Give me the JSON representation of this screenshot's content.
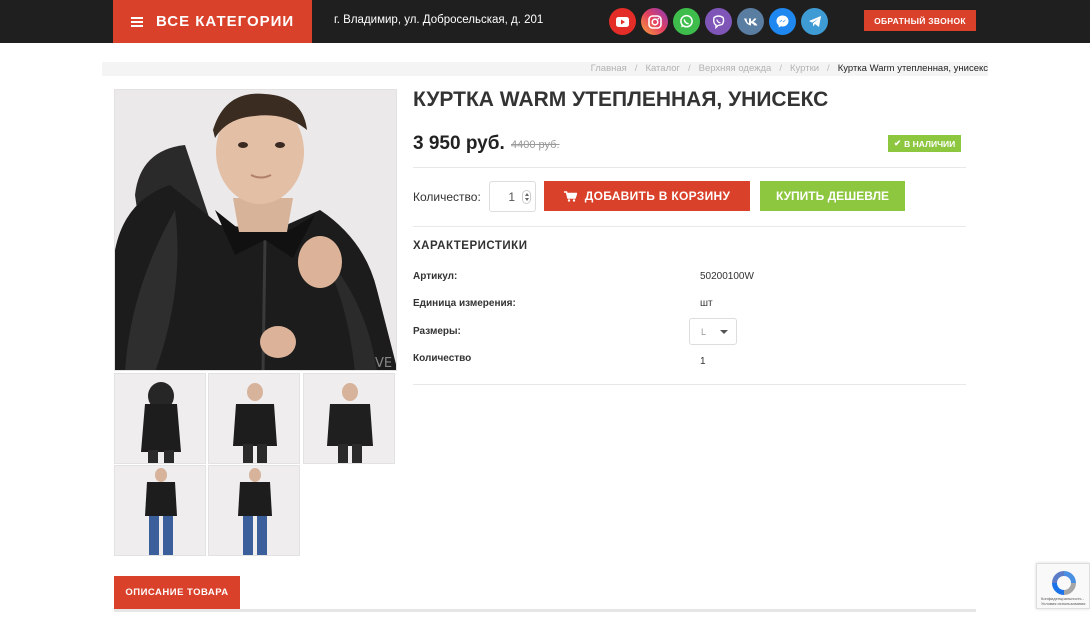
{
  "header": {
    "categories_label": "ВСЕ КАТЕГОРИИ",
    "address": "г. Владимир, ул. Добросельская, д. 201",
    "callback_label": "ОБРАТНЫЙ ЗВОНОК",
    "socials": [
      {
        "name": "youtube-icon",
        "color": "#e52d27"
      },
      {
        "name": "instagram-icon",
        "color": "#c13584"
      },
      {
        "name": "whatsapp-icon",
        "color": "#3ebd4d"
      },
      {
        "name": "viber-icon",
        "color": "#7f56b8"
      },
      {
        "name": "vk-icon",
        "color": "#5a7ea2"
      },
      {
        "name": "messenger-icon",
        "color": "#1e88f0"
      },
      {
        "name": "telegram-icon",
        "color": "#3f9bd3"
      }
    ]
  },
  "breadcrumbs": {
    "items": [
      "Главная",
      "Каталог",
      "Верхняя одежда",
      "Куртки"
    ],
    "current": "Куртка Warm утепленная, унисекс"
  },
  "product": {
    "title": "КУРТКА WARM УТЕПЛЕННАЯ, УНИСЕКС",
    "price": "3 950 руб.",
    "old_price": "4400 руб.",
    "stock": "В НАЛИЧИИ",
    "quantity_label": "Количество:",
    "quantity_value": "1",
    "add_to_cart": "ДОБАВИТЬ В КОРЗИНУ",
    "buy_cheaper": "КУПИТЬ ДЕШЕВЛЕ",
    "image_watermark": "VE"
  },
  "characteristics": {
    "title": "ХАРАКТЕРИСТИКИ",
    "rows": [
      {
        "key": "Артикул:",
        "value": "50200100W"
      },
      {
        "key": "Единица измерения:",
        "value": "шт"
      },
      {
        "key": "Размеры:",
        "value": "L"
      },
      {
        "key": "Количество",
        "value": "1"
      }
    ]
  },
  "tabs": {
    "description": "ОПИСАНИЕ ТОВАРА"
  },
  "recaptcha": {
    "text": "Конфиденциальность - Условия использования"
  },
  "colors": {
    "accent": "#d9412a",
    "green": "#8dc63f",
    "dark": "#1f1f1f"
  }
}
